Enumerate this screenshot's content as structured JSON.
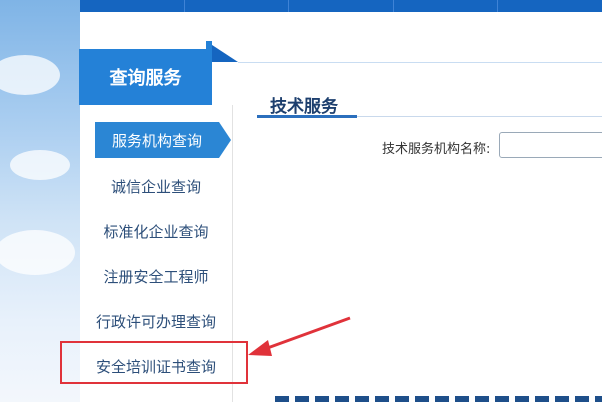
{
  "sidebar": {
    "header": "查询服务",
    "items": [
      {
        "label": "服务机构查询",
        "active": true
      },
      {
        "label": "诚信企业查询",
        "active": false
      },
      {
        "label": "标准化企业查询",
        "active": false
      },
      {
        "label": "注册安全工程师",
        "active": false
      },
      {
        "label": "行政许可办理查询",
        "active": false
      },
      {
        "label": "安全培训证书查询",
        "active": false
      }
    ]
  },
  "main": {
    "section_title": "技术服务",
    "field_label": "技术服务机构名称:",
    "field_value": ""
  },
  "colors": {
    "brand_blue": "#2481d7",
    "nav_blue": "#1565c0",
    "highlight_red": "#e0323a"
  }
}
